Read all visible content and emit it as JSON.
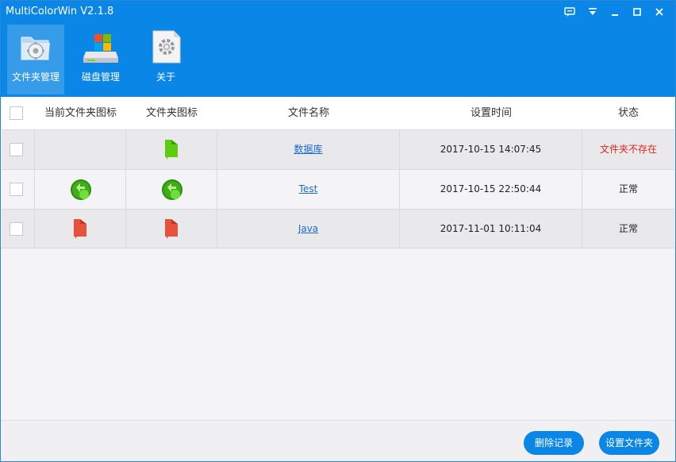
{
  "window": {
    "title": "MultiColorWin V2.1.8"
  },
  "toolbar": {
    "items": [
      {
        "label": "文件夹管理",
        "icon": "folder-manage-icon",
        "active": true
      },
      {
        "label": "磁盘管理",
        "icon": "disk-manage-icon",
        "active": false
      },
      {
        "label": "关于",
        "icon": "about-gear-icon",
        "active": false
      }
    ]
  },
  "table": {
    "headers": [
      "当前文件夹图标",
      "文件夹图标",
      "文件名称",
      "设置时间",
      "状态"
    ],
    "rows": [
      {
        "current_icon": "",
        "folder_icon": "green-folder-icon",
        "name": "数据库",
        "time": "2017-10-15 14:07:45",
        "status": "文件夹不存在",
        "status_color": "#e0261b"
      },
      {
        "current_icon": "green-ball-icon",
        "folder_icon": "green-ball-icon",
        "name": "Test",
        "time": "2017-10-15 22:50:44",
        "status": "正常",
        "status_color": "#222222"
      },
      {
        "current_icon": "red-folder-icon",
        "folder_icon": "red-folder-icon",
        "name": "Java",
        "time": "2017-11-01 10:11:04",
        "status": "正常",
        "status_color": "#222222"
      }
    ]
  },
  "footer": {
    "delete_label": "删除记录",
    "set_folder_label": "设置文件夹"
  },
  "colors": {
    "accent": "#0a87e6",
    "link": "#1a6bd1",
    "error": "#e0261b"
  }
}
